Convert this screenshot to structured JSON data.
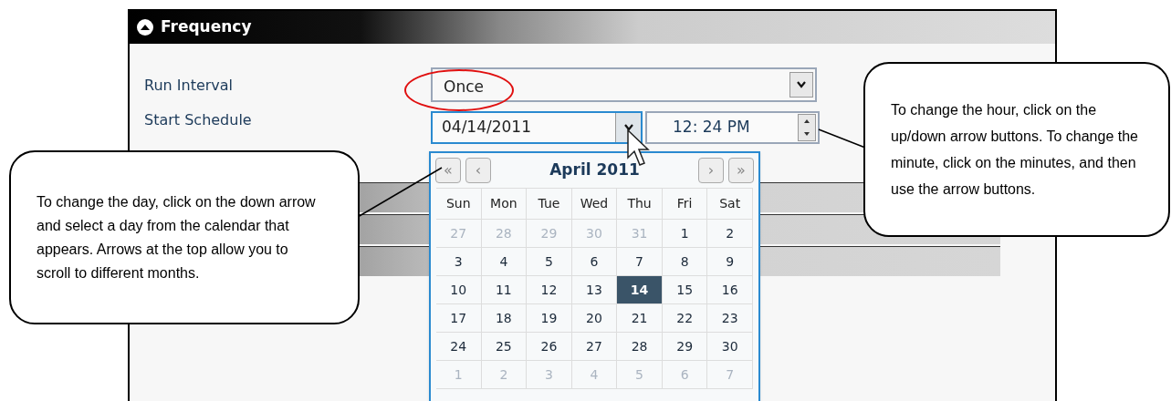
{
  "section": {
    "title": "Frequency",
    "expanded": true
  },
  "fields": [
    {
      "label": "Run Interval",
      "value": "Once",
      "highlighted": true
    },
    {
      "label": "Start Schedule",
      "date": "04/14/2011",
      "time": "12: 24 PM"
    }
  ],
  "calendar": {
    "month": "April 2011",
    "nav": [
      "«",
      "‹",
      "›",
      "»"
    ],
    "weekdays": [
      "Sun",
      "Mon",
      "Tue",
      "Wed",
      "Thu",
      "Fri",
      "Sat"
    ],
    "weeks": [
      [
        {
          "day": "27",
          "other_month": true,
          "selected": false
        },
        {
          "day": "28",
          "other_month": true,
          "selected": false
        },
        {
          "day": "29",
          "other_month": true,
          "selected": false
        },
        {
          "day": "30",
          "other_month": true,
          "selected": false
        },
        {
          "day": "31",
          "other_month": true,
          "selected": false
        },
        {
          "day": "1",
          "other_month": false,
          "selected": false
        },
        {
          "day": "2",
          "other_month": false,
          "selected": false
        }
      ],
      [
        {
          "day": "3",
          "other_month": false,
          "selected": false
        },
        {
          "day": "4",
          "other_month": false,
          "selected": false
        },
        {
          "day": "5",
          "other_month": false,
          "selected": false
        },
        {
          "day": "6",
          "other_month": false,
          "selected": false
        },
        {
          "day": "7",
          "other_month": false,
          "selected": false
        },
        {
          "day": "8",
          "other_month": false,
          "selected": false
        },
        {
          "day": "9",
          "other_month": false,
          "selected": false
        }
      ],
      [
        {
          "day": "10",
          "other_month": false,
          "selected": false
        },
        {
          "day": "11",
          "other_month": false,
          "selected": false
        },
        {
          "day": "12",
          "other_month": false,
          "selected": false
        },
        {
          "day": "13",
          "other_month": false,
          "selected": false
        },
        {
          "day": "14",
          "other_month": false,
          "selected": true
        },
        {
          "day": "15",
          "other_month": false,
          "selected": false
        },
        {
          "day": "16",
          "other_month": false,
          "selected": false
        }
      ],
      [
        {
          "day": "17",
          "other_month": false,
          "selected": false
        },
        {
          "day": "18",
          "other_month": false,
          "selected": false
        },
        {
          "day": "19",
          "other_month": false,
          "selected": false
        },
        {
          "day": "20",
          "other_month": false,
          "selected": false
        },
        {
          "day": "21",
          "other_month": false,
          "selected": false
        },
        {
          "day": "22",
          "other_month": false,
          "selected": false
        },
        {
          "day": "23",
          "other_month": false,
          "selected": false
        }
      ],
      [
        {
          "day": "24",
          "other_month": false,
          "selected": false
        },
        {
          "day": "25",
          "other_month": false,
          "selected": false
        },
        {
          "day": "26",
          "other_month": false,
          "selected": false
        },
        {
          "day": "27",
          "other_month": false,
          "selected": false
        },
        {
          "day": "28",
          "other_month": false,
          "selected": false
        },
        {
          "day": "29",
          "other_month": false,
          "selected": false
        },
        {
          "day": "30",
          "other_month": false,
          "selected": false
        }
      ],
      [
        {
          "day": "1",
          "other_month": true,
          "selected": false
        },
        {
          "day": "2",
          "other_month": true,
          "selected": false
        },
        {
          "day": "3",
          "other_month": true,
          "selected": false
        },
        {
          "day": "4",
          "other_month": true,
          "selected": false
        },
        {
          "day": "5",
          "other_month": true,
          "selected": false
        },
        {
          "day": "6",
          "other_month": true,
          "selected": false
        },
        {
          "day": "7",
          "other_month": true,
          "selected": false
        }
      ]
    ]
  },
  "callouts": [
    {
      "text": "To change the day, click on the down arrow and select a day from the calendar that appears. Arrows at the top allow you to scroll to different months."
    },
    {
      "text": "To change the hour, click on the up/down arrow buttons. To change the minute, click on the minutes, and then use the arrow buttons."
    }
  ]
}
